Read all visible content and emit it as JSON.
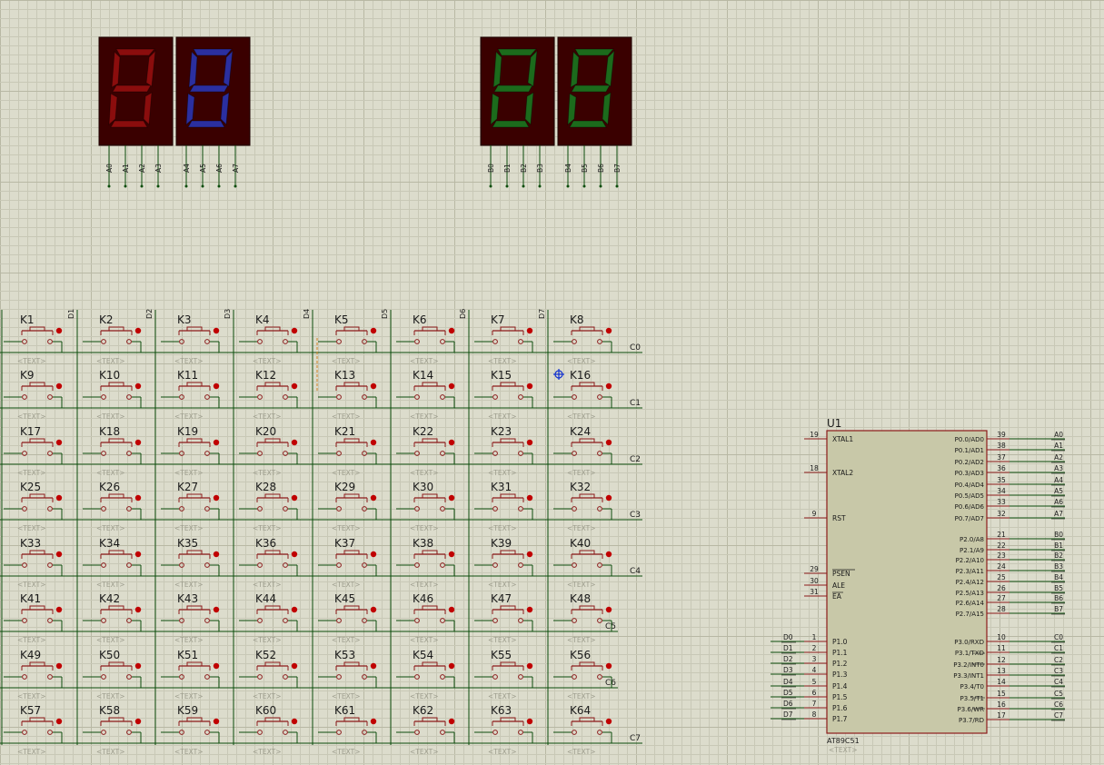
{
  "displays": [
    {
      "segment_color": "#8b0d0d",
      "pins": [
        "A0",
        "A1",
        "A2",
        "A3"
      ]
    },
    {
      "segment_color": "#2b2fa0",
      "pins": [
        "A4",
        "A5",
        "A6",
        "A7"
      ]
    },
    {
      "segment_color": "#1c6b1c",
      "pins": [
        "B0",
        "B1",
        "B2",
        "B3"
      ]
    },
    {
      "segment_color": "#1c6b1c",
      "pins": [
        "B4",
        "B5",
        "B6",
        "B7"
      ]
    }
  ],
  "display_digit": "8",
  "keypad": {
    "col_labels": [
      "D1",
      "D2",
      "D3",
      "D4",
      "D5",
      "D6",
      "D7"
    ],
    "row_labels": [
      "C0",
      "C1",
      "C2",
      "C3",
      "C4",
      "C5",
      "C6",
      "C7"
    ],
    "key_prefix": "K",
    "text_placeholder": "<TEXT>"
  },
  "mcu": {
    "ref": "U1",
    "part": "AT89C51",
    "text_placeholder": "<TEXT>",
    "left_pins": [
      {
        "num": "19",
        "name": "XTAL1",
        "net": ""
      },
      {
        "num": "18",
        "name": "XTAL2",
        "net": ""
      },
      {
        "num": "9",
        "name": "RST",
        "net": ""
      },
      {
        "num": "29",
        "name": "PSEN",
        "net": ""
      },
      {
        "num": "30",
        "name": "ALE",
        "net": ""
      },
      {
        "num": "31",
        "name": "EA",
        "net": ""
      },
      {
        "num": "1",
        "name": "P1.0",
        "net": "D0"
      },
      {
        "num": "2",
        "name": "P1.1",
        "net": "D1"
      },
      {
        "num": "3",
        "name": "P1.2",
        "net": "D2"
      },
      {
        "num": "4",
        "name": "P1.3",
        "net": "D3"
      },
      {
        "num": "5",
        "name": "P1.4",
        "net": "D4"
      },
      {
        "num": "6",
        "name": "P1.5",
        "net": "D5"
      },
      {
        "num": "7",
        "name": "P1.6",
        "net": "D6"
      },
      {
        "num": "8",
        "name": "P1.7",
        "net": "D7"
      }
    ],
    "right_pins": [
      {
        "num": "39",
        "name": "P0.0/AD0",
        "net": "A0"
      },
      {
        "num": "38",
        "name": "P0.1/AD1",
        "net": "A1"
      },
      {
        "num": "37",
        "name": "P0.2/AD2",
        "net": "A2"
      },
      {
        "num": "36",
        "name": "P0.3/AD3",
        "net": "A3"
      },
      {
        "num": "35",
        "name": "P0.4/AD4",
        "net": "A4"
      },
      {
        "num": "34",
        "name": "P0.5/AD5",
        "net": "A5"
      },
      {
        "num": "33",
        "name": "P0.6/AD6",
        "net": "A6"
      },
      {
        "num": "32",
        "name": "P0.7/AD7",
        "net": "A7"
      },
      {
        "num": "21",
        "name": "P2.0/A8",
        "net": "B0"
      },
      {
        "num": "22",
        "name": "P2.1/A9",
        "net": "B1"
      },
      {
        "num": "23",
        "name": "P2.2/A10",
        "net": "B2"
      },
      {
        "num": "24",
        "name": "P2.3/A11",
        "net": "B3"
      },
      {
        "num": "25",
        "name": "P2.4/A12",
        "net": "B4"
      },
      {
        "num": "26",
        "name": "P2.5/A13",
        "net": "B5"
      },
      {
        "num": "27",
        "name": "P2.6/A14",
        "net": "B6"
      },
      {
        "num": "28",
        "name": "P2.7/A15",
        "net": "B7"
      },
      {
        "num": "10",
        "name": "P3.0/RXD",
        "net": "C0"
      },
      {
        "num": "11",
        "name": "P3.1/TXD",
        "net": "C1"
      },
      {
        "num": "12",
        "name": "P3.2/INT0",
        "net": "C2"
      },
      {
        "num": "13",
        "name": "P3.3/INT1",
        "net": "C3"
      },
      {
        "num": "14",
        "name": "P3.4/T0",
        "net": "C4"
      },
      {
        "num": "15",
        "name": "P3.5/T1",
        "net": "C5"
      },
      {
        "num": "16",
        "name": "P3.6/WR",
        "net": "C6"
      },
      {
        "num": "17",
        "name": "P3.7/RD",
        "net": "C7"
      }
    ]
  },
  "colors": {
    "background": "#dcdccc",
    "grid_minor": "#c8c8b6",
    "grid_major": "#b8b8a4",
    "wire": "#0b4d0b",
    "component": "#8b1a1a",
    "pin_dot": "#c00000",
    "chip_fill": "#c8c8a8",
    "display_body": "#3a0000",
    "text_dim": "#9c9c8c"
  }
}
